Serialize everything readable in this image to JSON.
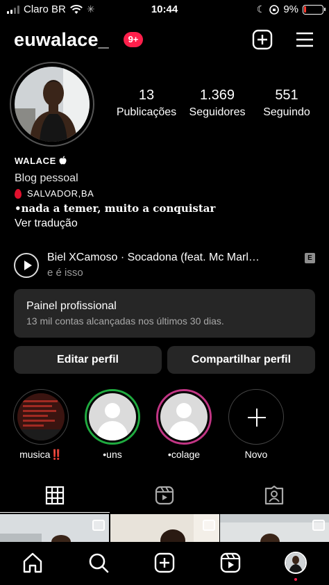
{
  "status_bar": {
    "carrier": "Claro BR",
    "time": "10:44",
    "battery": "9%"
  },
  "header": {
    "username": "euwalace_",
    "notifications_badge": "9+"
  },
  "profile": {
    "stats": [
      {
        "value": "13",
        "label": "Publicações"
      },
      {
        "value": "1.369",
        "label": "Seguidores"
      },
      {
        "value": "551",
        "label": "Seguindo"
      }
    ],
    "display_name": "WALACE",
    "category": "Blog pessoal",
    "location": "SALVADOR,BA",
    "bio_quote": "•nada a temer, muito a conquistar",
    "translate_link": "Ver tradução"
  },
  "music": {
    "title": "Biel XCamoso · Socadona (feat. Mc Marl…",
    "subtitle": "e é isso",
    "explicit_badge": "E"
  },
  "professional_panel": {
    "title": "Painel profissional",
    "subtitle": "13 mil contas alcançadas nos últimos 30 dias."
  },
  "buttons": {
    "edit_profile": "Editar perfil",
    "share_profile": "Compartilhar perfil"
  },
  "highlights": [
    {
      "label": "musica‼️"
    },
    {
      "label": "•uns"
    },
    {
      "label": "•colage"
    },
    {
      "label": "Novo"
    }
  ],
  "tabs": [
    "grid-icon",
    "reels-icon",
    "tagged-icon"
  ],
  "nav": [
    "home-icon",
    "search-icon",
    "create-icon",
    "reels-icon",
    "profile-avatar"
  ],
  "colors": {
    "background": "#000000",
    "card": "#262626",
    "badge": "#ff1f4b",
    "muted_text": "#a8a8a8"
  }
}
